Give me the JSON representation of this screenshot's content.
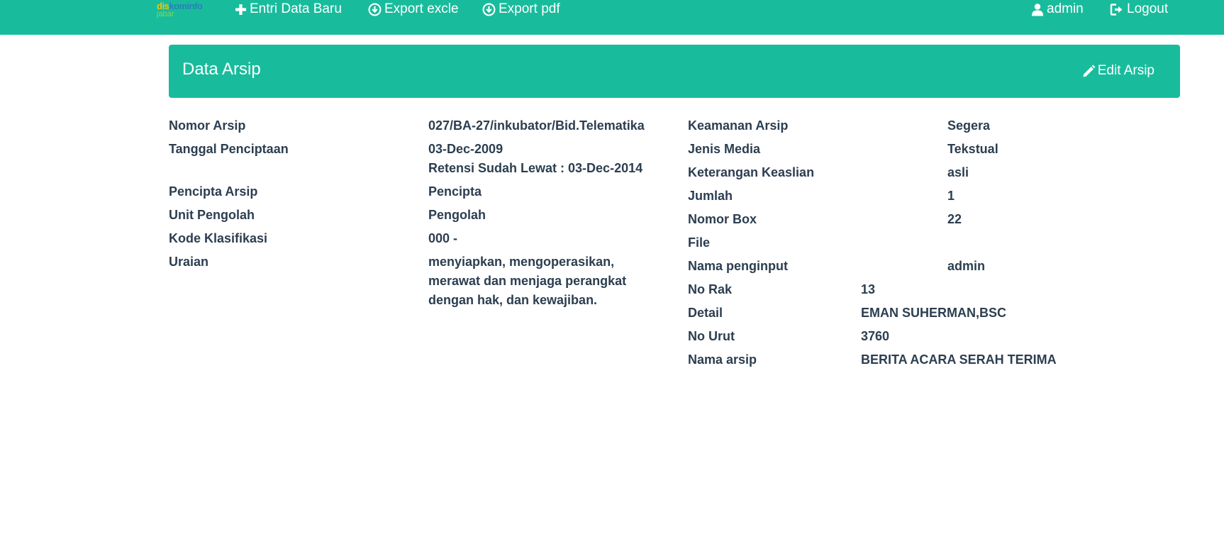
{
  "navbar": {
    "brand_line1_part1": "dis",
    "brand_line1_part2": "kominfo",
    "brand_line2": "jabar",
    "links": [
      {
        "label": "Entri Data Baru",
        "icon": "plus-icon"
      },
      {
        "label": "Export excle",
        "icon": "download-circle-icon"
      },
      {
        "label": "Export pdf",
        "icon": "download-circle-icon"
      }
    ],
    "user_label": "admin",
    "logout_label": "Logout"
  },
  "panel": {
    "title": "Data Arsip",
    "edit_label": "Edit Arsip"
  },
  "left_fields": [
    {
      "label": "Nomor Arsip",
      "value": "027/BA-27/inkubator/Bid.Telematika"
    },
    {
      "label": "Tanggal Penciptaan",
      "value": "03-Dec-2009",
      "note": "Retensi Sudah Lewat : 03-Dec-2014"
    },
    {
      "label": "Pencipta Arsip",
      "value": "Pencipta"
    },
    {
      "label": "Unit Pengolah",
      "value": "Pengolah"
    },
    {
      "label": "Kode Klasifikasi",
      "value": "000 -"
    },
    {
      "label": "Uraian",
      "value_lines": [
        "menyiapkan, mengoperasikan,",
        "merawat dan menjaga perangkat",
        "dengan hak, dan kewajiban."
      ]
    }
  ],
  "right_fields": [
    {
      "label": "Keamanan Arsip",
      "value": "Segera"
    },
    {
      "label": "Jenis Media",
      "value": "Tekstual"
    },
    {
      "label": "Keterangan Keaslian",
      "value": "asli"
    },
    {
      "label": "Jumlah",
      "value": "1"
    },
    {
      "label": "Nomor Box",
      "value": "22"
    },
    {
      "label": "File",
      "value": ""
    },
    {
      "label": "Nama penginput",
      "value": "admin"
    },
    {
      "label": "No Rak",
      "value": "13"
    },
    {
      "label": "Detail",
      "value": "EMAN SUHERMAN,BSC"
    },
    {
      "label": "No Urut",
      "value": "3760"
    },
    {
      "label": "Nama arsip",
      "value": "BERITA ACARA SERAH TERIMA"
    }
  ],
  "colors": {
    "brand_green": "#18bc9c",
    "text_dark": "#2c3e50"
  }
}
